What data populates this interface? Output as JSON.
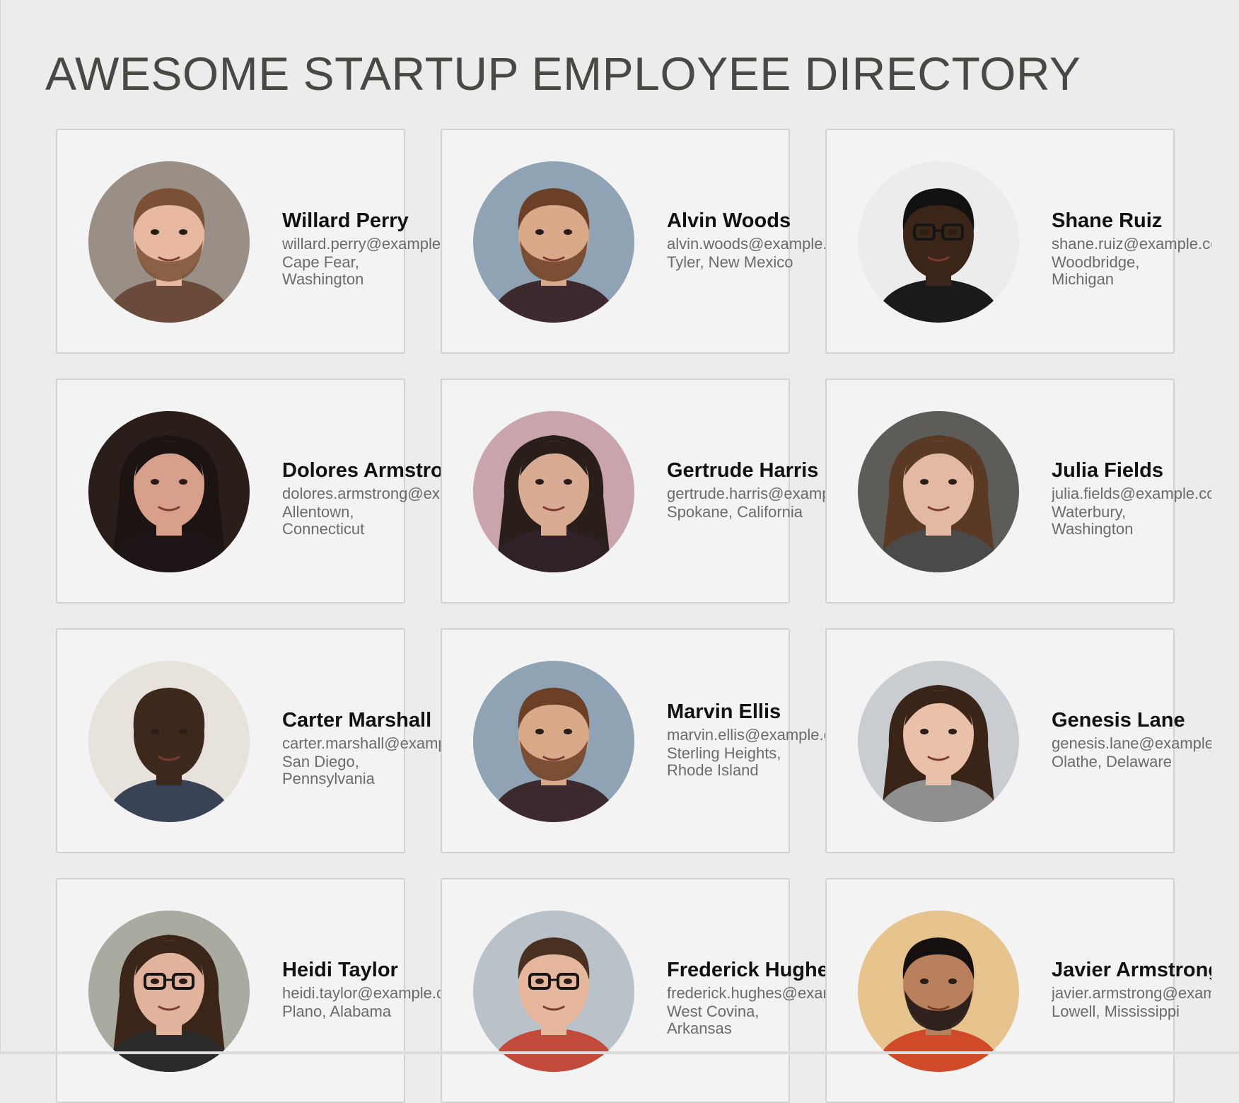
{
  "page": {
    "title": "AWESOME STARTUP EMPLOYEE DIRECTORY"
  },
  "employees": [
    {
      "name": "Willard Perry",
      "email": "willard.perry@example.com",
      "location": "Cape Fear, Washington",
      "skin": "#e8b9a0",
      "hair": "#7a5136",
      "shirt": "#6a4a3a",
      "bg": "#9a8f87",
      "beard": true,
      "glasses": false,
      "long_hair": false
    },
    {
      "name": "Alvin Woods",
      "email": "alvin.woods@example.com",
      "location": "Tyler, New Mexico",
      "skin": "#d9a98a",
      "hair": "#6b4026",
      "shirt": "#3c2a2e",
      "bg": "#8fa3b5",
      "beard": true,
      "glasses": false,
      "long_hair": false
    },
    {
      "name": "Shane Ruiz",
      "email": "shane.ruiz@example.com",
      "location": "Woodbridge, Michigan",
      "skin": "#3b2519",
      "hair": "#111111",
      "shirt": "#1a1a1a",
      "bg": "#ececec",
      "beard": false,
      "glasses": true,
      "long_hair": false
    },
    {
      "name": "Dolores Armstrong",
      "email": "dolores.armstrong@example.com",
      "location": "Allentown, Connecticut",
      "skin": "#d8a08a",
      "hair": "#1b1412",
      "shirt": "#1e1616",
      "bg": "#2b1d1a",
      "beard": false,
      "glasses": false,
      "long_hair": true
    },
    {
      "name": "Gertrude Harris",
      "email": "gertrude.harris@example.com",
      "location": "Spokane, California",
      "skin": "#d9ab93",
      "hair": "#2a1e1a",
      "shirt": "#2e2228",
      "bg": "#c9a4ad",
      "beard": false,
      "glasses": false,
      "long_hair": true
    },
    {
      "name": "Julia Fields",
      "email": "julia.fields@example.com",
      "location": "Waterbury, Washington",
      "skin": "#e4b9a3",
      "hair": "#5a3a25",
      "shirt": "#4a4a4a",
      "bg": "#5d5c58",
      "beard": false,
      "glasses": false,
      "long_hair": true
    },
    {
      "name": "Carter Marshall",
      "email": "carter.marshall@example.com",
      "location": "San Diego, Pennsylvania",
      "skin": "#3d281c",
      "hair": "#3d281c",
      "shirt": "#3a4255",
      "bg": "#e7e2dc",
      "beard": false,
      "glasses": false,
      "long_hair": false
    },
    {
      "name": "Marvin Ellis",
      "email": "marvin.ellis@example.com",
      "location": "Sterling Heights, Rhode Island",
      "skin": "#d9a98a",
      "hair": "#6b4026",
      "shirt": "#3c2a2e",
      "bg": "#8fa3b5",
      "beard": true,
      "glasses": false,
      "long_hair": false
    },
    {
      "name": "Genesis Lane",
      "email": "genesis.lane@example.com",
      "location": "Olathe, Delaware",
      "skin": "#e8c1a8",
      "hair": "#3a2418",
      "shirt": "#8f8f8f",
      "bg": "#c9ccd0",
      "beard": false,
      "glasses": false,
      "long_hair": true
    },
    {
      "name": "Heidi Taylor",
      "email": "heidi.taylor@example.com",
      "location": "Plano, Alabama",
      "skin": "#e2b39c",
      "hair": "#3b2519",
      "shirt": "#2a2a2a",
      "bg": "#a9aaa0",
      "beard": false,
      "glasses": true,
      "long_hair": true
    },
    {
      "name": "Frederick Hughes",
      "email": "frederick.hughes@example.com",
      "location": "West Covina, Arkansas",
      "skin": "#e6b79c",
      "hair": "#4a3020",
      "shirt": "#c24a3a",
      "bg": "#b9c2c8",
      "beard": false,
      "glasses": true,
      "long_hair": false
    },
    {
      "name": "Javier Armstrong",
      "email": "javier.armstrong@example.com",
      "location": "Lowell, Mississippi",
      "skin": "#b8805c",
      "hair": "#161010",
      "shirt": "#d04a2a",
      "bg": "#e7c48d",
      "beard": true,
      "glasses": false,
      "long_hair": false
    }
  ]
}
